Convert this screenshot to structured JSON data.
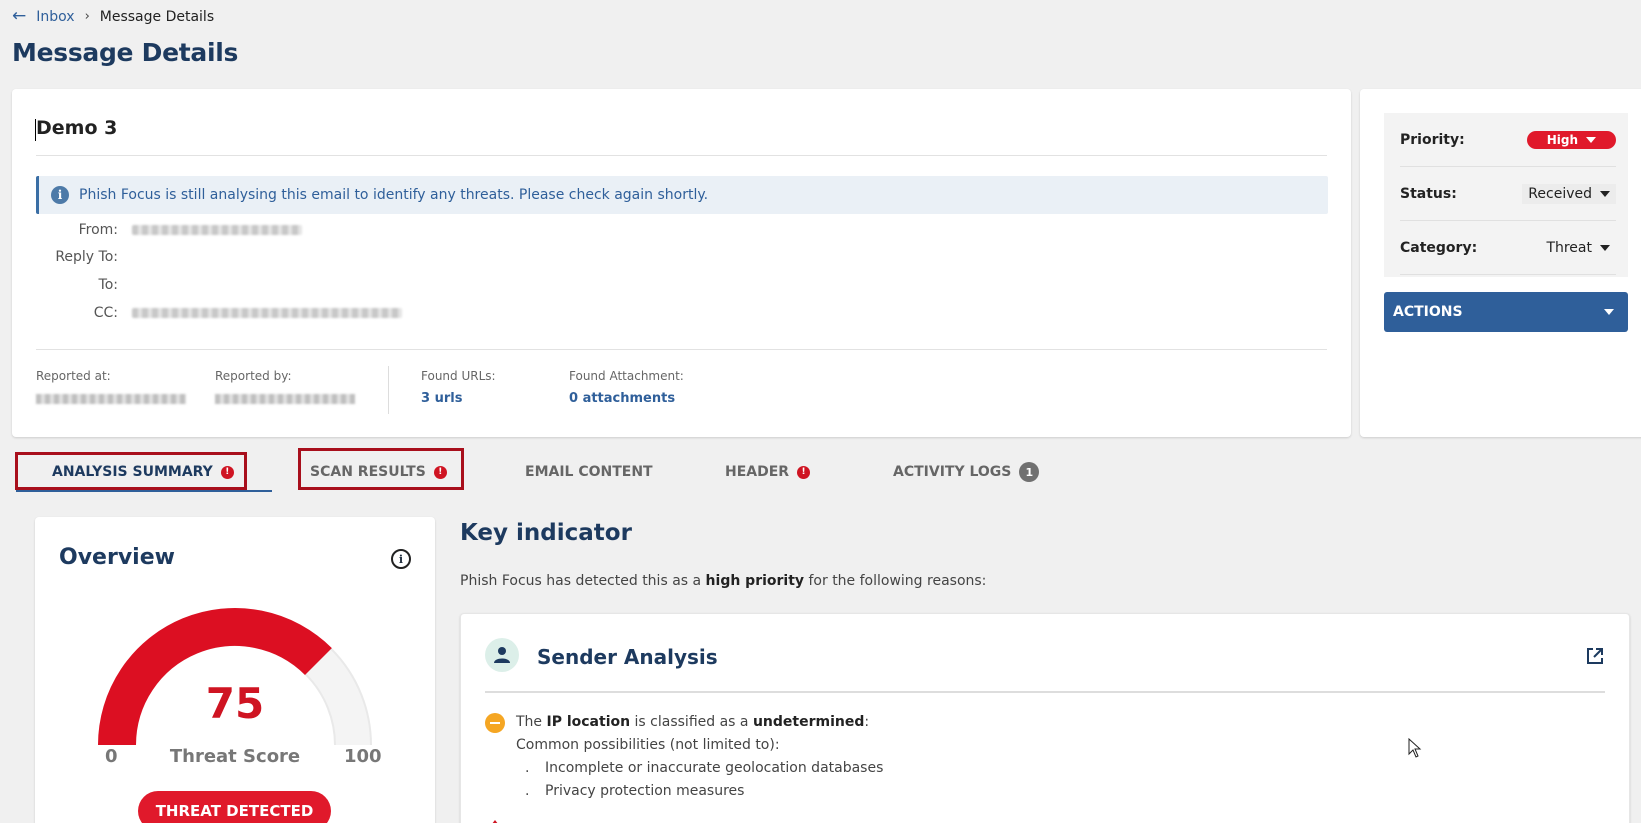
{
  "breadcrumb": {
    "back_label": "←",
    "parent": "Inbox",
    "separator": "›",
    "current": "Message Details"
  },
  "page_title": "Message Details",
  "message": {
    "subject": "Demo 3",
    "info_banner": "Phish Focus is still analysing this email to identify any threats. Please check again shortly.",
    "fields": {
      "from_label": "From:",
      "reply_to_label": "Reply To:",
      "to_label": "To:",
      "cc_label": "CC:"
    },
    "meta": {
      "reported_at_label": "Reported at:",
      "reported_by_label": "Reported by:",
      "found_urls_label": "Found URLs:",
      "found_urls_value": "3 urls",
      "found_attachment_label": "Found Attachment:",
      "found_attachment_value": "0 attachments"
    }
  },
  "side_panel": {
    "priority_label": "Priority:",
    "priority_value": "High",
    "status_label": "Status:",
    "status_value": "Received",
    "category_label": "Category:",
    "category_value": "Threat",
    "actions_label": "ACTIONS"
  },
  "tabs": [
    {
      "label": "ANALYSIS SUMMARY",
      "alert": "!"
    },
    {
      "label": "SCAN RESULTS",
      "alert": "!"
    },
    {
      "label": "EMAIL CONTENT"
    },
    {
      "label": "HEADER",
      "alert": "!"
    },
    {
      "label": "ACTIVITY LOGS",
      "count": "1"
    }
  ],
  "overview": {
    "title": "Overview",
    "score": "75",
    "score_value": 75,
    "score_label": "Threat Score",
    "min": "0",
    "max": "100",
    "status": "THREAT DETECTED"
  },
  "key_indicator": {
    "title": "Key indicator",
    "desc_prefix": "Phish Focus has detected this as a ",
    "desc_bold": "high priority",
    "desc_suffix": " for the following reasons:"
  },
  "sender_analysis": {
    "title": "Sender Analysis",
    "line1_prefix": "The ",
    "line1_bold1": "IP location",
    "line1_mid": " is classified as a ",
    "line1_bold2": "undetermined",
    "line1_suffix": ":",
    "line2": "Common possibilities (not limited to):",
    "bullet_marker": ".",
    "bullets": [
      "Incomplete or inaccurate geolocation databases",
      "Privacy protection measures"
    ]
  },
  "colors": {
    "accent": "#2f5f9a",
    "danger": "#e0192b",
    "title": "#1d3a5f",
    "warning": "#f5a623"
  },
  "icons": [
    "back-arrow-icon",
    "info-icon",
    "caret-down-icon",
    "alert-icon",
    "person-icon",
    "external-link-icon",
    "warning-minus-icon",
    "mouse-cursor-icon"
  ]
}
